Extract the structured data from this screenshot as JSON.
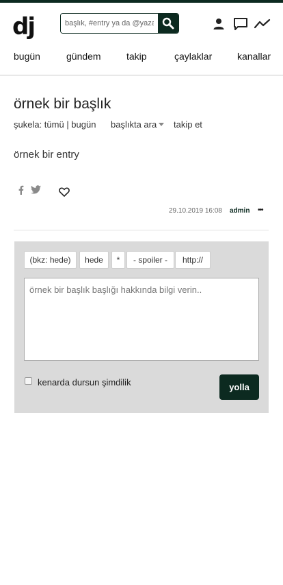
{
  "header": {
    "logo": "dj",
    "search": {
      "placeholder": "başlık, #entry ya da @yazar"
    },
    "icons": [
      "search-icon",
      "user-icon",
      "messages-icon",
      "activity-icon"
    ]
  },
  "nav": {
    "items": [
      "bugün",
      "gündem",
      "takip",
      "çaylaklar",
      "kanallar"
    ]
  },
  "topic": {
    "title": "örnek bir başlık",
    "filter_label": "şukela: tümü | bugün",
    "search_in_topic": "başlıkta ara",
    "follow": "takip et"
  },
  "entry": {
    "text": "örnek bir entry",
    "date": "29.10.2019 16:08",
    "author": "admin",
    "more": "•••"
  },
  "editor": {
    "toolbar": [
      "(bkz: hede)",
      "hede",
      "*",
      "- spoiler -",
      "http://"
    ],
    "placeholder": "örnek bir başlık başlığı hakkında bilgi verin..",
    "draft_label": "kenarda dursun şimdilik",
    "submit": "yolla"
  },
  "colors": {
    "primary": "#0c2a20",
    "editor_bg": "#dadada",
    "author": "#0c2a20"
  }
}
